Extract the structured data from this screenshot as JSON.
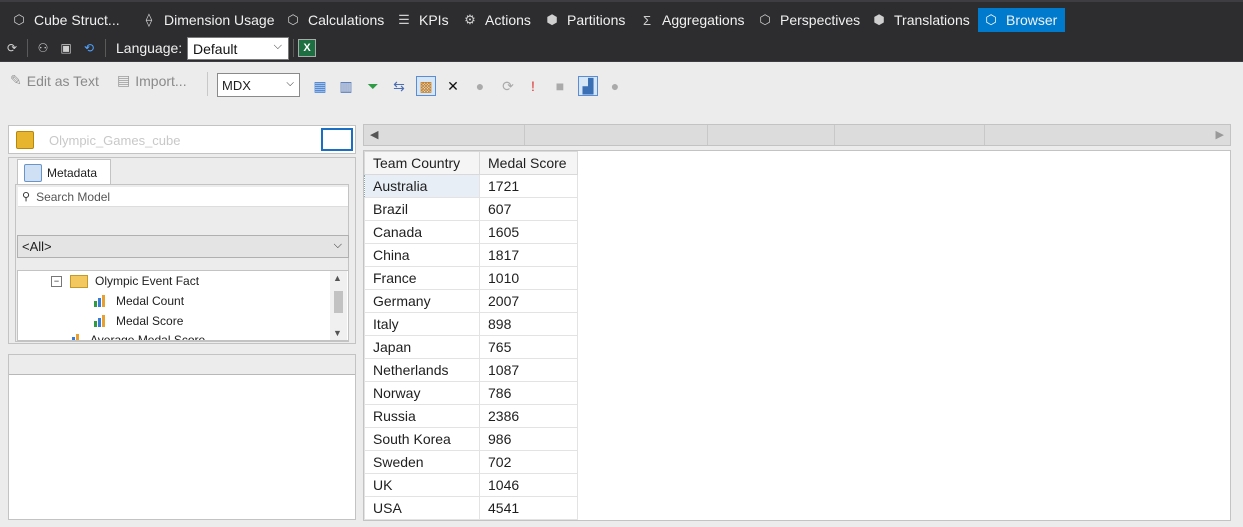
{
  "tabs": [
    {
      "label": "Cube Struct...",
      "icon": "cube-structure-icon"
    },
    {
      "label": "Dimension Usage",
      "icon": "dimension-usage-icon"
    },
    {
      "label": "Calculations",
      "icon": "calculations-icon"
    },
    {
      "label": "KPIs",
      "icon": "kpis-icon"
    },
    {
      "label": "Actions",
      "icon": "actions-icon"
    },
    {
      "label": "Partitions",
      "icon": "partitions-icon"
    },
    {
      "label": "Aggregations",
      "icon": "aggregations-icon"
    },
    {
      "label": "Perspectives",
      "icon": "perspectives-icon"
    },
    {
      "label": "Translations",
      "icon": "translations-icon"
    },
    {
      "label": "Browser",
      "icon": "browser-icon",
      "active": true
    }
  ],
  "toolbar2": {
    "language_label": "Language:",
    "language_value": "Default",
    "excel_glyph": "X"
  },
  "toolbar": {
    "edit_as_text": "Edit as Text",
    "import": "Import...",
    "query_language": "MDX"
  },
  "metadata": {
    "cube_name": "Olympic_Games_cube",
    "tab_label": "Metadata",
    "search_placeholder": "Search Model",
    "filter_value": "<All>",
    "tree": {
      "folder": "Olympic Event Fact",
      "items": [
        "Medal Count",
        "Medal Score"
      ],
      "partial_item": "Average Medal Score"
    }
  },
  "grid": {
    "columns": [
      "Team Country",
      "Medal Score"
    ],
    "rows": [
      [
        "Australia",
        "1721"
      ],
      [
        "Brazil",
        "607"
      ],
      [
        "Canada",
        "1605"
      ],
      [
        "China",
        "1817"
      ],
      [
        "France",
        "1010"
      ],
      [
        "Germany",
        "2007"
      ],
      [
        "Italy",
        "898"
      ],
      [
        "Japan",
        "765"
      ],
      [
        "Netherlands",
        "1087"
      ],
      [
        "Norway",
        "786"
      ],
      [
        "Russia",
        "2386"
      ],
      [
        "South Korea",
        "986"
      ],
      [
        "Sweden",
        "702"
      ],
      [
        "UK",
        "1046"
      ],
      [
        "USA",
        "4541"
      ]
    ]
  },
  "colors": {
    "dark_bar": "#2d2d30",
    "active_tab": "#007acc",
    "panel_bg": "#ececec"
  }
}
